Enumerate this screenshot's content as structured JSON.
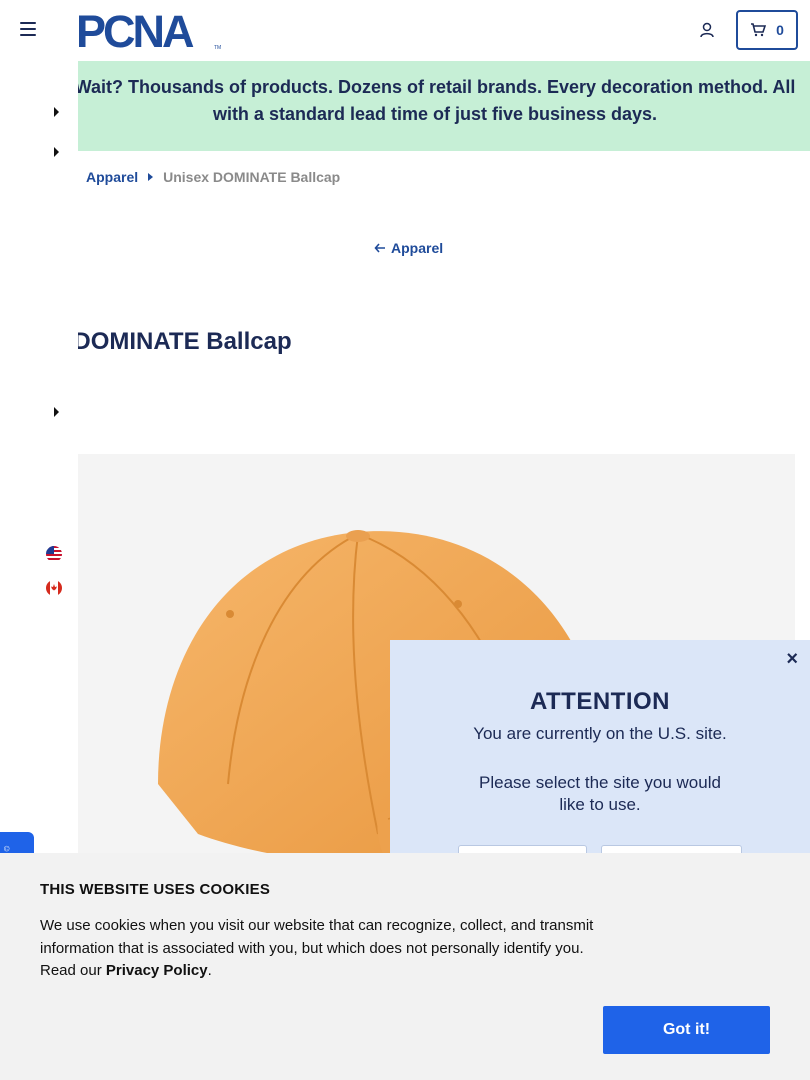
{
  "header": {
    "logo_text": "PCNA",
    "cart_count": "0"
  },
  "promo": {
    "text": "Wait? Thousands of products. Dozens of retail brands. Every decoration method. All with a standard lead time of just five business days."
  },
  "breadcrumb": {
    "items": [
      "Apparel",
      "Unisex DOMINATE Ballcap"
    ]
  },
  "back_link": "Apparel",
  "product": {
    "title": "ex DOMINATE Ballcap",
    "cap_color": "#f0a95a"
  },
  "attention": {
    "title": "ATTENTION",
    "line1": "You are currently on the U.S. site.",
    "line2": "Please select the site you would like to use.",
    "close": "×"
  },
  "cookie": {
    "title": "THIS WEBSITE USES COOKIES",
    "text": "We use cookies when you visit our website that can recognize, collect, and transmit information that is associated with you, but which does not personally identify you. Read our ",
    "link": "Privacy Policy",
    "end": ".",
    "button": "Got it!"
  },
  "colors": {
    "brand_blue": "#1f4b9a",
    "promo_bg": "#c6efd6",
    "cta_blue": "#1f63e8"
  }
}
